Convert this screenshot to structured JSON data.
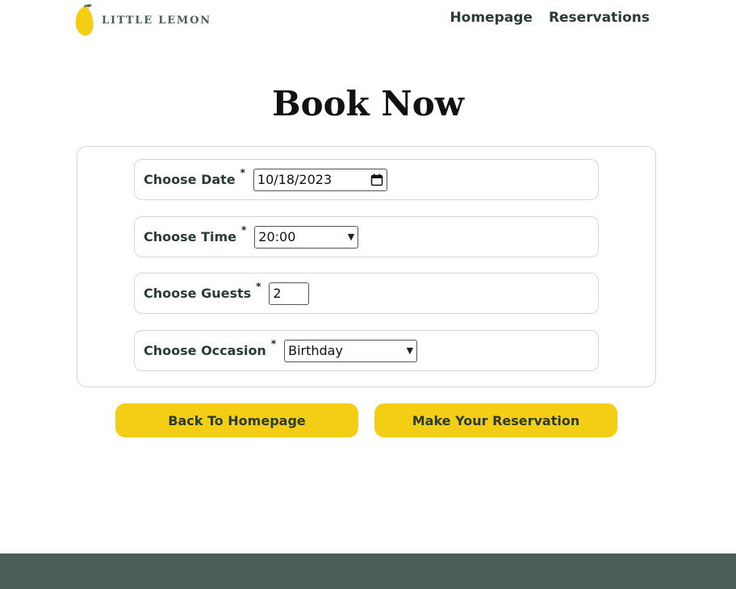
{
  "header": {
    "logo_text": "LITTLE LEMON",
    "nav": [
      {
        "label": "Homepage"
      },
      {
        "label": "Reservations"
      }
    ]
  },
  "page": {
    "title": "Book Now"
  },
  "form": {
    "required_marker": "*",
    "date": {
      "label": "Choose Date",
      "value": "10/18/2023"
    },
    "time": {
      "label": "Choose Time",
      "value": "20:00"
    },
    "guests": {
      "label": "Choose Guests",
      "value": "2"
    },
    "occasion": {
      "label": "Choose Occasion",
      "value": "Birthday"
    }
  },
  "buttons": {
    "back": "Back To Homepage",
    "submit": "Make Your Reservation"
  },
  "colors": {
    "primary_yellow": "#f4ce14",
    "primary_green": "#495e57",
    "logo_lemon": "#f4ce14"
  },
  "icons": {
    "date_picker": "calendar-icon",
    "dropdown": "chevron-down-icon"
  }
}
